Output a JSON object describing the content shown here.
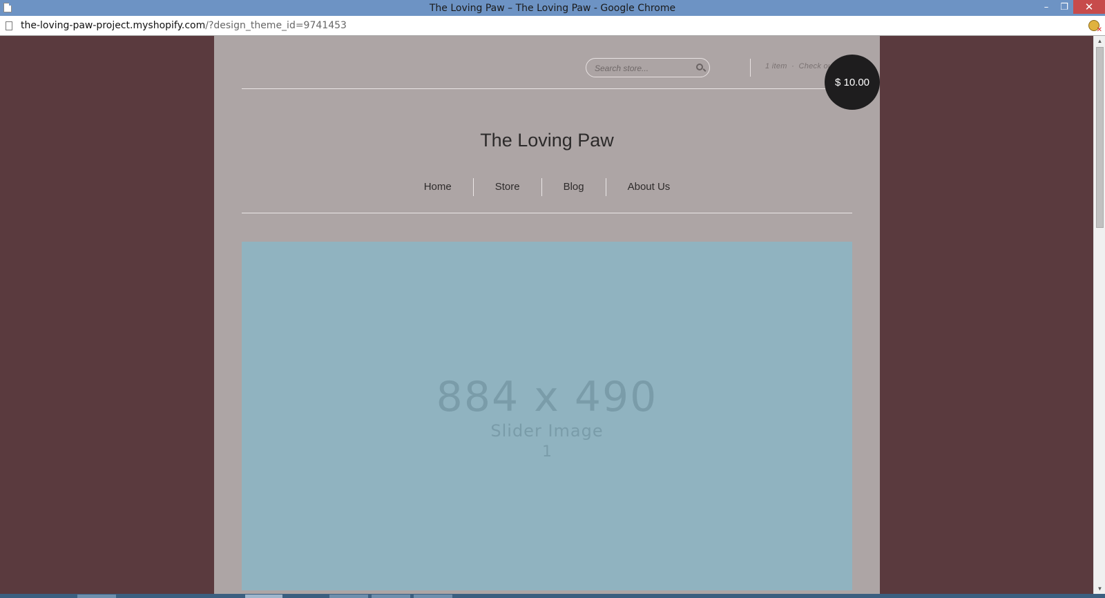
{
  "window": {
    "title": "The Loving Paw – The Loving Paw - Google Chrome",
    "controls": {
      "minimize": "–",
      "restore": "❐",
      "close": "✕"
    }
  },
  "address": {
    "host": "the-loving-paw-project.myshopify.com",
    "path": "/?design_theme_id=9741453"
  },
  "header": {
    "search": {
      "placeholder": "Search store..."
    },
    "cart": {
      "items": "1 item",
      "separator": "·",
      "checkout": "Check out",
      "total": "$ 10.00"
    }
  },
  "site": {
    "title": "The Loving Paw"
  },
  "nav": {
    "items": [
      "Home",
      "Store",
      "Blog",
      "About Us"
    ]
  },
  "slider": {
    "dimensions": "884 x 490",
    "label": "Slider Image",
    "number": "1"
  },
  "colors": {
    "outer_background": "#5a3a3e",
    "page_background": "#ada5a5",
    "slider_background": "#90b3c0",
    "cart_badge": "#1e1d1e",
    "titlebar": "#6d93c4"
  },
  "icons": [
    "doc-icon",
    "page-icon",
    "extension-icon",
    "search-icon",
    "scroll-up-icon",
    "scroll-down-icon"
  ]
}
